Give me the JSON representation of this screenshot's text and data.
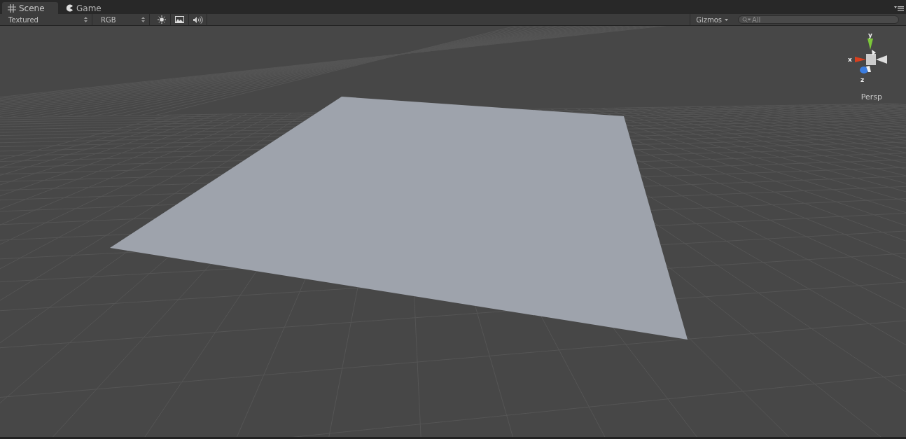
{
  "tabs": [
    {
      "label": "Scene",
      "selected": true,
      "kind": "grid"
    },
    {
      "label": "Game",
      "selected": false,
      "kind": "pacman"
    }
  ],
  "toolbar": {
    "draw_mode": "Textured",
    "render_mode": "RGB",
    "toggles": [
      {
        "kind": "lighting",
        "on": false
      },
      {
        "kind": "image_effects",
        "on": false
      },
      {
        "kind": "audio",
        "on": false
      }
    ],
    "gizmos": "Gizmos",
    "search": {
      "placeholder": "All"
    }
  },
  "scene": {
    "axes": {
      "x": "x",
      "y": "y",
      "z": "z"
    },
    "projection": "Persp"
  }
}
